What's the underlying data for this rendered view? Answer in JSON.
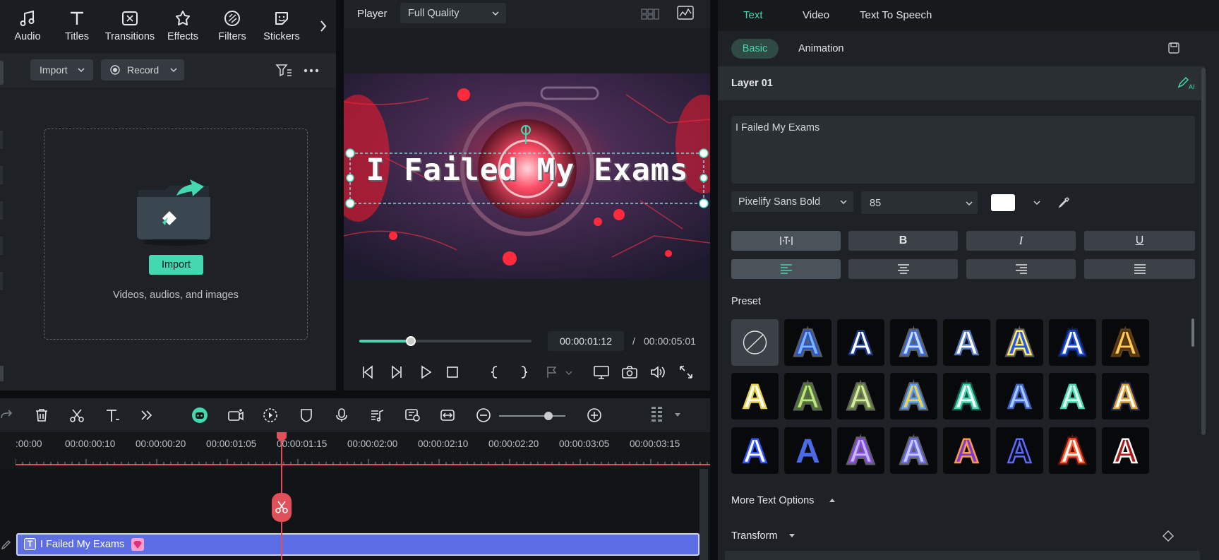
{
  "toolbar": {
    "items": [
      {
        "label": "Audio",
        "icon": "music-note-icon"
      },
      {
        "label": "Titles",
        "icon": "text-t-icon"
      },
      {
        "label": "Transitions",
        "icon": "transitions-icon"
      },
      {
        "label": "Effects",
        "icon": "effects-star-icon"
      },
      {
        "label": "Filters",
        "icon": "filters-icon"
      },
      {
        "label": "Stickers",
        "icon": "stickers-icon"
      }
    ]
  },
  "media": {
    "import_label": "Import",
    "record_label": "Record",
    "drop_button": "Import",
    "drop_hint": "Videos, audios, and images"
  },
  "player": {
    "label": "Player",
    "quality": "Full Quality",
    "overlay_text": "I Failed My Exams",
    "current_time": "00:00:01:12",
    "separator": "/",
    "total_time": "00:00:05:01",
    "progress": 0.3
  },
  "timeline": {
    "ticks": [
      ":00:00",
      "00:00:00:10",
      "00:00:00:20",
      "00:00:01:05",
      "00:00:01:15",
      "00:00:02:00",
      "00:00:02:10",
      "00:00:02:20",
      "00:00:03:05",
      "00:00:03:15"
    ],
    "clip_label": "I Failed My Exams",
    "zoom": 0.74
  },
  "inspector": {
    "tabs": [
      "Text",
      "Video",
      "Text To Speech"
    ],
    "subtabs": [
      "Basic",
      "Animation"
    ],
    "layer_title": "Layer 01",
    "text_value": "I Failed My Exams",
    "font": "Pixelify Sans Bold",
    "size": "85",
    "text_color": "#ffffff",
    "style_buttons": [
      "B",
      "I",
      "U"
    ],
    "preset_label": "Preset",
    "more_options": "More Text Options",
    "transform": "Transform",
    "accent": "#43d8b0"
  }
}
